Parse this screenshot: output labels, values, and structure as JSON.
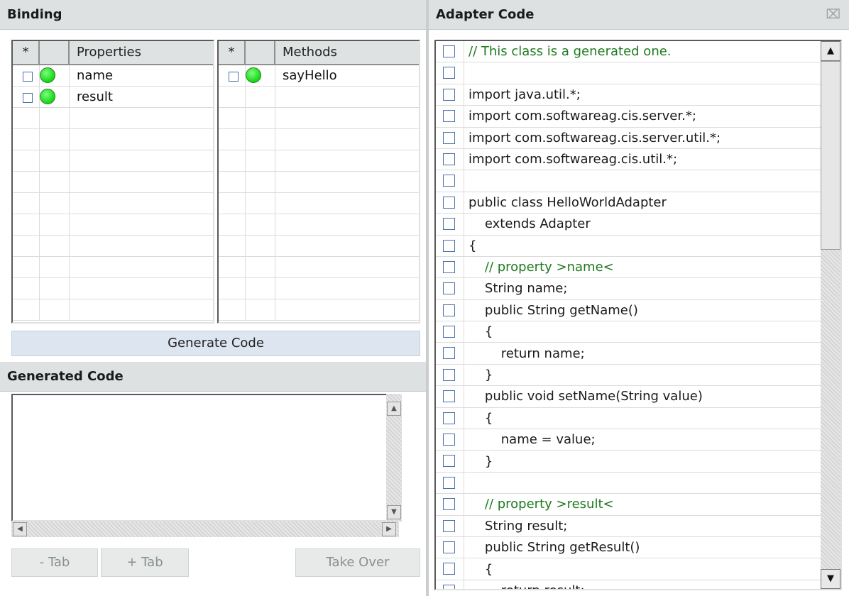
{
  "binding": {
    "title": "Binding",
    "properties_grid": {
      "headers": [
        "*",
        "",
        "Properties"
      ],
      "rows": [
        {
          "name": "name",
          "checked": false,
          "status": "green-circle"
        },
        {
          "name": "result",
          "checked": false,
          "status": "green-circle"
        }
      ]
    },
    "methods_grid": {
      "headers": [
        "*",
        "",
        "Methods"
      ],
      "rows": [
        {
          "name": "sayHello",
          "checked": false,
          "status": "green-circle"
        }
      ]
    },
    "generate_label": "Generate Code"
  },
  "generated": {
    "title": "Generated Code",
    "content": "",
    "minus_tab_label": "- Tab",
    "plus_tab_label": "+ Tab",
    "take_over_label": "Take Over"
  },
  "adapter": {
    "title": "Adapter Code",
    "close_icon": "close-icon",
    "lines": [
      {
        "text": "// This class is a generated one.",
        "comment": true
      },
      {
        "text": "",
        "comment": false
      },
      {
        "text": "import java.util.*;",
        "comment": false
      },
      {
        "text": "import com.softwareag.cis.server.*;",
        "comment": false
      },
      {
        "text": "import com.softwareag.cis.server.util.*;",
        "comment": false
      },
      {
        "text": "import com.softwareag.cis.util.*;",
        "comment": false
      },
      {
        "text": "",
        "comment": false
      },
      {
        "text": "public class HelloWorldAdapter",
        "comment": false
      },
      {
        "text": "    extends Adapter",
        "comment": false
      },
      {
        "text": "{",
        "comment": false
      },
      {
        "text": "    // property >name<",
        "comment": true
      },
      {
        "text": "    String name;",
        "comment": false
      },
      {
        "text": "    public String getName()",
        "comment": false
      },
      {
        "text": "    {",
        "comment": false
      },
      {
        "text": "        return name;",
        "comment": false
      },
      {
        "text": "    }",
        "comment": false
      },
      {
        "text": "    public void setName(String value)",
        "comment": false
      },
      {
        "text": "    {",
        "comment": false
      },
      {
        "text": "        name = value;",
        "comment": false
      },
      {
        "text": "    }",
        "comment": false
      },
      {
        "text": "",
        "comment": false
      },
      {
        "text": "    // property >result<",
        "comment": true
      },
      {
        "text": "    String result;",
        "comment": false
      },
      {
        "text": "    public String getResult()",
        "comment": false
      },
      {
        "text": "    {",
        "comment": false
      },
      {
        "text": "        return result;",
        "comment": false
      }
    ]
  },
  "colors": {
    "header_bg": "#dde1e1",
    "comment": "#1e7a1e",
    "checkbox_border": "#4b72a8",
    "status_green": "#14d614"
  }
}
